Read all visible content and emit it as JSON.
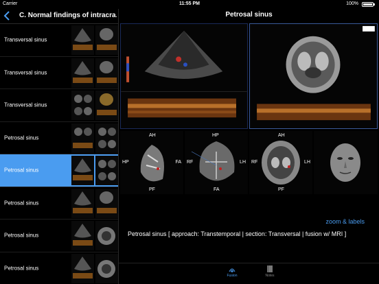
{
  "status_bar": {
    "carrier": "Carrier",
    "time": "11:55 PM",
    "battery": "100%"
  },
  "sidebar": {
    "title": "C. Normal findings of intracra...",
    "items": [
      {
        "label": "Transversal sinus",
        "selected": false
      },
      {
        "label": "Transversal sinus",
        "selected": false
      },
      {
        "label": "Transversal sinus",
        "selected": false
      },
      {
        "label": "Petrosal sinus",
        "selected": false
      },
      {
        "label": "Petrosal sinus",
        "selected": true
      },
      {
        "label": "Petrosal sinus",
        "selected": false
      },
      {
        "label": "Petrosal sinus",
        "selected": false
      },
      {
        "label": "Petrosal sinus",
        "selected": false
      }
    ]
  },
  "main": {
    "title": "Petrosal sinus",
    "slices": [
      {
        "top": "AH",
        "bottom": "PF",
        "left": "HP",
        "right": "FA"
      },
      {
        "top": "HP",
        "bottom": "FA",
        "left": "RF",
        "right": "LH"
      },
      {
        "top": "AH",
        "bottom": "PF",
        "left": "RF",
        "right": "LH"
      }
    ],
    "zoom_link": "zoom & labels",
    "caption": "Petrosal sinus   [ approach: Transtemporal | section: Transversal | fusion w/ MRI ]"
  },
  "tabbar": {
    "fusion": "Fusion",
    "notes": "Notes"
  },
  "colors": {
    "accent": "#4a9cf0",
    "background": "#000000"
  }
}
